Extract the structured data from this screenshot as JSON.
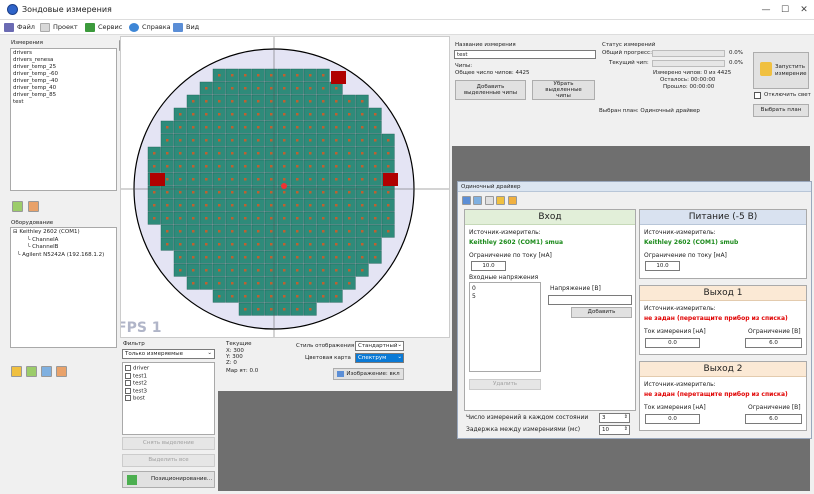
{
  "window": {
    "title": "Зондовые измерения",
    "minimize": "—",
    "maximize": "☐",
    "close": "✕"
  },
  "menu": [
    {
      "label": "Файл",
      "color": "#6b6bb3"
    },
    {
      "label": "Проект",
      "color": "#7aa7d8"
    },
    {
      "label": "Сервис",
      "color": "#3c9a3c"
    },
    {
      "label": "Справка",
      "color": "#3d86d6"
    },
    {
      "label": "Вид",
      "color": "#5b8ed6"
    }
  ],
  "left": {
    "measurements_title": "Измерения",
    "measurements": [
      "drivers",
      "drivers_renesa",
      "driver_temp_25",
      "driver_temp_-60",
      "driver_temp_-40",
      "driver_temp_40",
      "driver_temp_85",
      "test"
    ],
    "equipment_title": "Оборудование",
    "equipment": [
      {
        "text": "Keithley 2602 (COM1)",
        "indent": 0
      },
      {
        "text": "ChannelA",
        "indent": 2
      },
      {
        "text": "ChannelB",
        "indent": 2
      },
      {
        "text": "Agilent N5242A (192.168.1.2)",
        "indent": 1
      }
    ]
  },
  "wafer": {
    "fps_label": "FPS 1"
  },
  "filter": {
    "title": "Фильтр",
    "select": "Только измеряемые",
    "items": [
      "driver",
      "test1",
      "test2",
      "test3",
      "bost"
    ],
    "clear_selection": "Снять выделение",
    "select_all": "Выделить все",
    "positioning": "Позиционирование..."
  },
  "current": {
    "title": "Текущие",
    "x": "X: 300",
    "y": "Y: 300",
    "z": "Z: 0",
    "map": "Мар ят: 0.0"
  },
  "display": {
    "style_label": "Стиль отображения",
    "style_value": "Стандартный",
    "color_label": "Цветовая карта",
    "color_value": "Спектрум",
    "image_button": "Изображение: вкл"
  },
  "meas_info": {
    "name_label": "Название измерения",
    "name_value": "test",
    "chips_label": "Чипы:",
    "total_chips": "Общее число чипов: 4425",
    "add_chips": "Добавить выделенные чипы",
    "remove_chips": "Убрать выделенные чипы"
  },
  "status": {
    "title": "Статус измерений",
    "overall": "Общий прогресс:",
    "overall_pct": "0.0%",
    "current_chip": "Текущий чип:",
    "current_pct": "0.0%",
    "measured": "Измерено чипов: 0 из 4425",
    "remaining": "Осталось: 00:00:00",
    "elapsed": "Прошло: 00:00:00",
    "start_button": "Запустить измерение",
    "turn_off_light": "Отключить свет",
    "selected_plan": "Выбран план: Одиночный драйвер",
    "choose_plan": "Выбрать план"
  },
  "dialog": {
    "title": "Одиночный драйвер",
    "input": {
      "title": "Вход",
      "source_label": "Источник-измеритель:",
      "source_value": "Keithley 2602 (COM1) smua",
      "limit_label": "Ограничение по току [мА]",
      "limit_value": "10.0",
      "voltages_label": "Входные напряжения",
      "voltages": [
        "0",
        "5"
      ],
      "voltage_label": "Напряжение [В]",
      "voltage_value": "",
      "add": "Добавить",
      "remove": "Удалить"
    },
    "power": {
      "title": "Питание (-5 В)",
      "source_label": "Источник-измеритель:",
      "source_value": "Keithley 2602 (COM1) smub",
      "limit_label": "Ограничение по току [мА]",
      "limit_value": "10.0"
    },
    "out1": {
      "title": "Выход 1",
      "source_label": "Источник-измеритель:",
      "source_value": "не задан (перетащите прибор из списка)",
      "current_label": "Ток измерения [нА]",
      "current_value": "0.0",
      "limit_label": "Ограничение [В]",
      "limit_value": "6.0"
    },
    "out2": {
      "title": "Выход 2",
      "source_label": "Источник-измеритель:",
      "source_value": "не задан (перетащите прибор из списка)",
      "current_label": "Ток измерения [нА]",
      "current_value": "0.0",
      "limit_label": "Ограничение [В]",
      "limit_value": "6.0"
    },
    "count_label": "Число измерений в каждом состоянии",
    "count_value": "3",
    "delay_label": "Задержка между измерениями (мс)",
    "delay_value": "10"
  }
}
